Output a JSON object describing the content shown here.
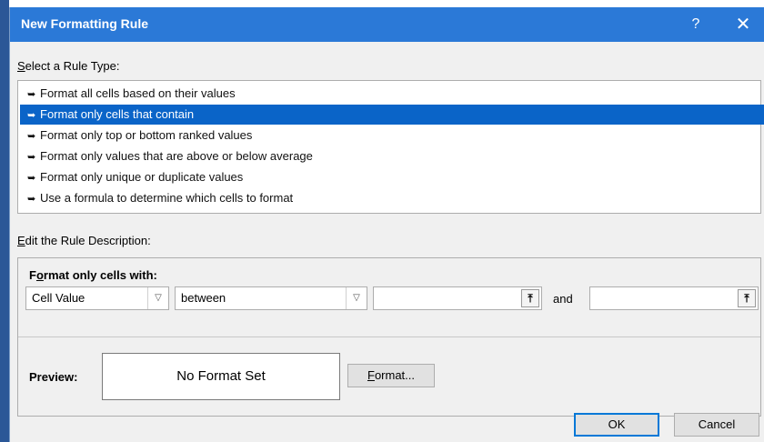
{
  "dialog": {
    "title": "New Formatting Rule",
    "help": "?",
    "close": "✕"
  },
  "rule_type": {
    "label_mnemonic": "S",
    "label_rest": "elect a Rule Type:",
    "items": [
      {
        "label": "Format all cells based on their values",
        "selected": false
      },
      {
        "label": "Format only cells that contain",
        "selected": true
      },
      {
        "label": "Format only top or bottom ranked values",
        "selected": false
      },
      {
        "label": "Format only values that are above or below average",
        "selected": false
      },
      {
        "label": "Format only unique or duplicate values",
        "selected": false
      },
      {
        "label": "Use a formula to determine which cells to format",
        "selected": false
      }
    ]
  },
  "description": {
    "label_mnemonic": "E",
    "label_rest": "dit the Rule Description:",
    "format_only_prefix": "F",
    "format_only_mnemonic": "o",
    "format_only_rest": "rmat only cells with:",
    "condition_combo": "Cell Value",
    "operator_combo": "between",
    "value1": "",
    "and_label": "and",
    "value2": ""
  },
  "preview": {
    "label": "Preview:",
    "text": "No Format Set",
    "format_button_mnemonic": "F",
    "format_button_rest": "ormat..."
  },
  "footer": {
    "ok": "OK",
    "cancel": "Cancel"
  },
  "colors": {
    "titlebar": "#2b79d7",
    "selection": "#0a64c8",
    "dialog_bg": "#f0f0f0"
  }
}
